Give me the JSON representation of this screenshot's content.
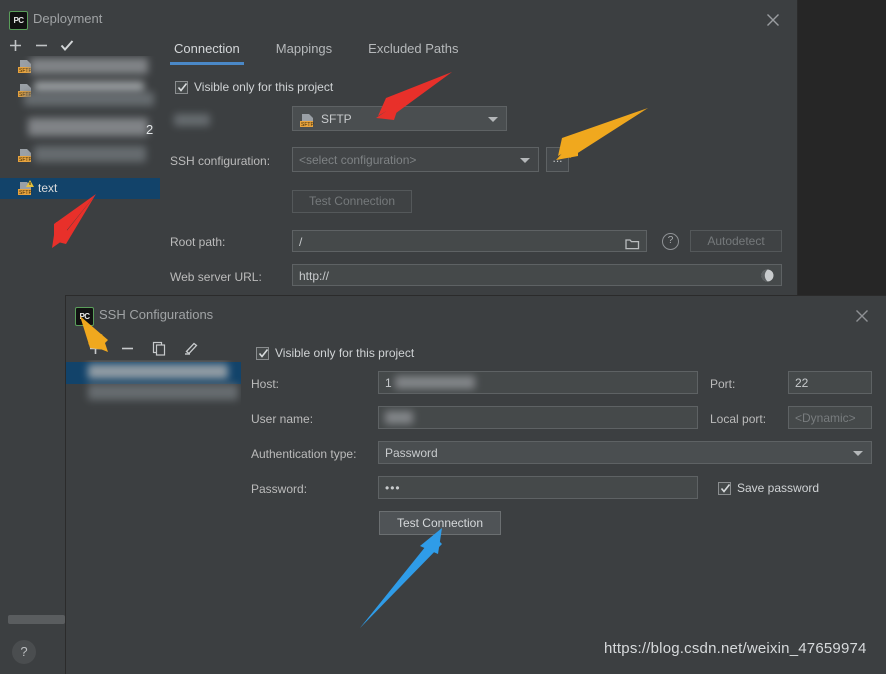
{
  "colors": {
    "dialog_bg": "#3c3f41",
    "backdrop": "#262626",
    "accent_tab": "#4a88c7",
    "selection": "#12436a",
    "arrow_red": "#e8302a",
    "arrow_orange": "#f0a81e",
    "arrow_blue": "#2f9ce8"
  },
  "deployment_dialog": {
    "title": "Deployment",
    "app_icon": "PC",
    "close_icon": "close-icon",
    "toolbar": [
      {
        "name": "add-button",
        "glyph": "+"
      },
      {
        "name": "remove-button",
        "glyph": "−"
      },
      {
        "name": "use-as-default-button",
        "glyph": "✓"
      }
    ],
    "server_list": {
      "badge": "2",
      "selected_item_label": "text",
      "items": [
        {
          "label": "",
          "icon": "sftp-icon",
          "redacted": true
        },
        {
          "label": "",
          "icon": "sftp-icon",
          "redacted": true
        },
        {
          "label": "",
          "icon": "sftp-icon",
          "redacted": true
        },
        {
          "label": "text",
          "icon": "sftp-icon",
          "redacted": false,
          "selected": true
        }
      ]
    },
    "tabs": [
      {
        "label": "Connection",
        "active": true
      },
      {
        "label": "Mappings",
        "active": false
      },
      {
        "label": "Excluded Paths",
        "active": false
      }
    ],
    "visible_only_checkbox": {
      "label": "Visible only for this project",
      "checked": true
    },
    "type_row": {
      "label": "",
      "redacted": true,
      "value": "SFTP",
      "icon": "sftp-icon"
    },
    "ssh_configuration": {
      "label": "SSH configuration:",
      "placeholder": "<select configuration>",
      "value": "",
      "browse_button_label": "..."
    },
    "test_connection_button": {
      "label": "Test Connection",
      "enabled": false
    },
    "root_path": {
      "label": "Root path:",
      "value": "/",
      "browse_icon": "folder-icon"
    },
    "help_icon": "help-icon",
    "autodetect_button": {
      "label": "Autodetect",
      "enabled": false
    },
    "web_server_url": {
      "label": "Web server URL:",
      "value": "http://",
      "trailing_icon": "globe-icon"
    },
    "bottom_help_button": "?"
  },
  "ssh_dialog": {
    "title": "SSH Configurations",
    "app_icon": "PC",
    "close_icon": "close-icon",
    "toolbar": [
      {
        "name": "add-button",
        "glyph": "+"
      },
      {
        "name": "remove-button",
        "glyph": "−"
      },
      {
        "name": "copy-button",
        "glyph": "copy-icon"
      },
      {
        "name": "edit-button",
        "glyph": "pencil-icon"
      }
    ],
    "config_list": {
      "items": [
        {
          "label": "",
          "redacted": true,
          "selected": true
        }
      ]
    },
    "visible_only_checkbox": {
      "label": "Visible only for this project",
      "checked": true
    },
    "host": {
      "label": "Host:",
      "value": "1",
      "redacted": true
    },
    "port": {
      "label": "Port:",
      "value": "22"
    },
    "user_name": {
      "label": "User name:",
      "value": "",
      "redacted": true
    },
    "local_port": {
      "label": "Local port:",
      "value": "<Dynamic>",
      "placeholder": true
    },
    "authentication_type": {
      "label": "Authentication type:",
      "value": "Password"
    },
    "password": {
      "label": "Password:",
      "value": "•••"
    },
    "save_password": {
      "label": "Save password",
      "checked": true
    },
    "test_connection_button": {
      "label": "Test Connection",
      "enabled": true
    }
  },
  "watermark": {
    "text": "https://blog.csdn.net/weixin_47659974"
  },
  "annotations": [
    {
      "name": "red-arrow-sftp",
      "color": "#e8302a"
    },
    {
      "name": "red-arrow-text-item",
      "color": "#e8302a"
    },
    {
      "name": "orange-arrow-browse-button",
      "color": "#f0a81e"
    },
    {
      "name": "orange-arrow-add-config",
      "color": "#f0a81e"
    },
    {
      "name": "blue-arrow-test-connection",
      "color": "#2f9ce8"
    }
  ]
}
